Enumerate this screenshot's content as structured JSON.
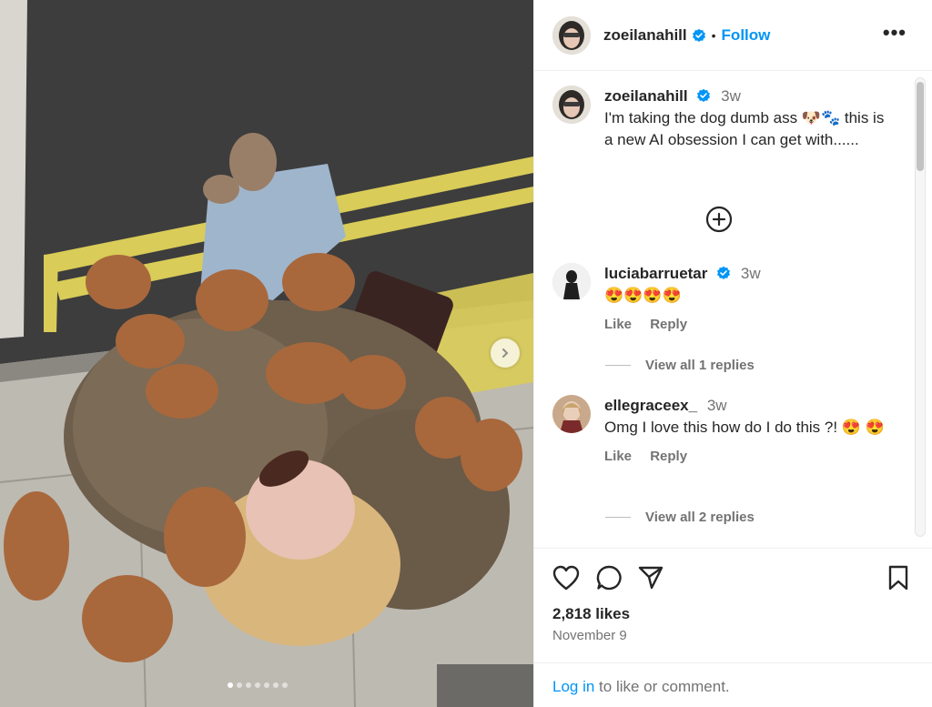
{
  "post": {
    "username": "zoeilanahill",
    "follow_label": "Follow",
    "separator": "•",
    "more_label": "•••"
  },
  "caption": {
    "username": "zoeilanahill",
    "time": "3w",
    "text": "I'm taking the dog dumb ass 🐶🐾 this is a new AI obsession I can get with......"
  },
  "comments": [
    {
      "username": "luciabarruetar",
      "verified": true,
      "time": "3w",
      "text": "😍😍😍😍",
      "like_label": "Like",
      "reply_label": "Reply",
      "view_replies": "View all 1 replies"
    },
    {
      "username": "ellegraceex_",
      "verified": false,
      "time": "3w",
      "text": "Omg I love this how do I do this ?! 😍 😍",
      "like_label": "Like",
      "reply_label": "Reply",
      "view_replies": "View all 2 replies"
    }
  ],
  "footer": {
    "likes": "2,818 likes",
    "date": "November 9",
    "login_link": "Log in",
    "login_rest": " to like or comment."
  },
  "carousel": {
    "count": 7,
    "active_index": 0
  },
  "colors": {
    "link": "#0095f6",
    "verified": "#0095f6",
    "muted": "#737373"
  },
  "icons": [
    "verified-badge-icon",
    "more-options-icon",
    "heart-icon",
    "comment-icon",
    "share-icon",
    "bookmark-icon",
    "plus-circle-icon",
    "chevron-right-icon"
  ]
}
